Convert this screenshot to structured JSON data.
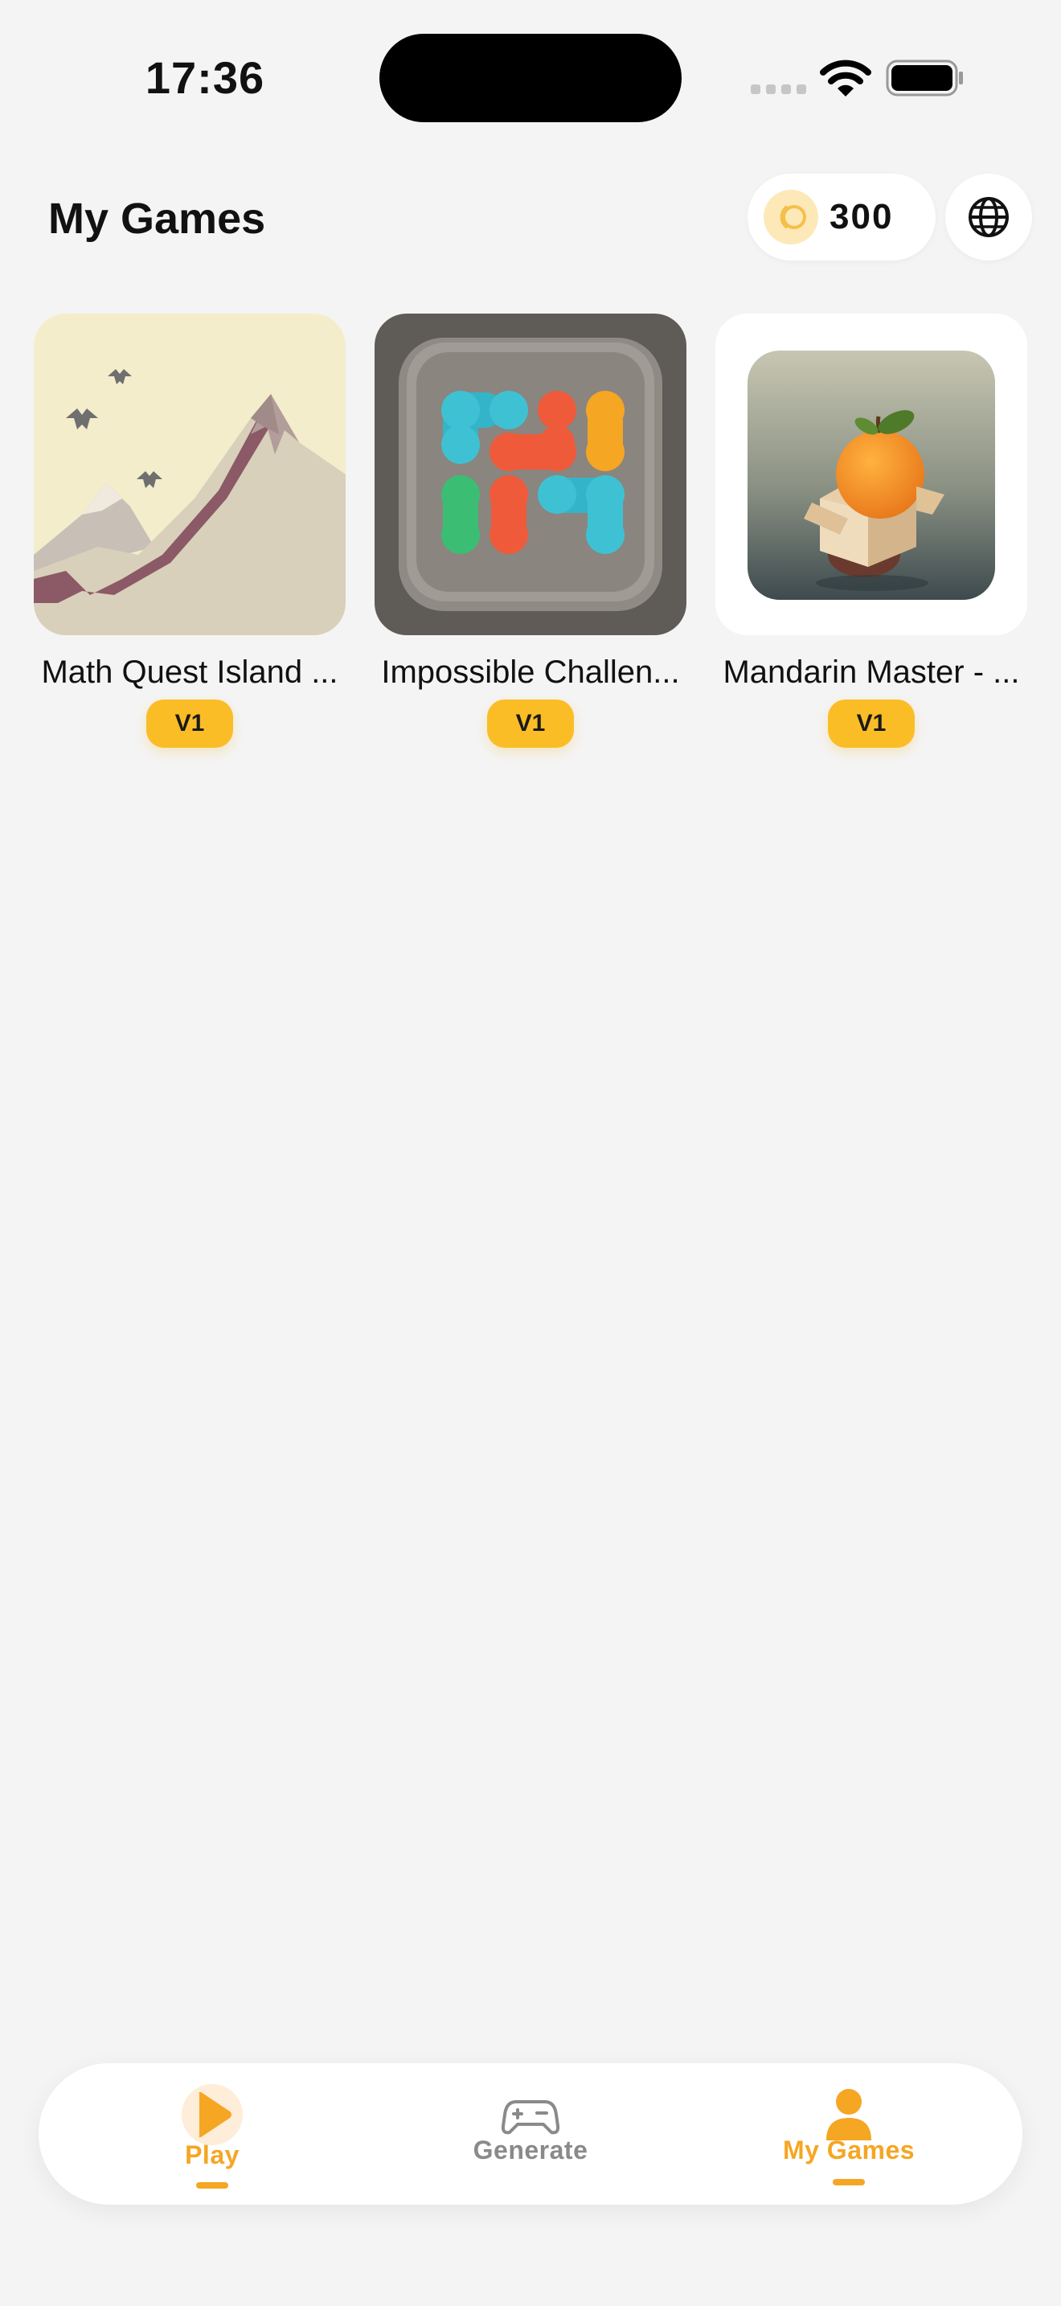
{
  "status_bar": {
    "time": "17:36",
    "icons": [
      "cellular-signal-icon",
      "wifi-icon",
      "battery-icon"
    ]
  },
  "header": {
    "title": "My Games",
    "coins": "300",
    "coin_icon": "coin-icon",
    "language_icon": "globe-icon"
  },
  "games": [
    {
      "title": "Math Quest Island ...",
      "version": "V1",
      "thumbnail": "mountain-landscape-art"
    },
    {
      "title": "Impossible Challen...",
      "version": "V1",
      "thumbnail": "colored-dots-puzzle-art"
    },
    {
      "title": "Mandarin Master - ...",
      "version": "V1",
      "thumbnail": "orange-in-box-art"
    }
  ],
  "tab_bar": {
    "tabs": [
      {
        "label": "Play",
        "icon": "play-icon",
        "active": false
      },
      {
        "label": "Generate",
        "icon": "gamepad-icon",
        "active": false
      },
      {
        "label": "My Games",
        "icon": "user-icon",
        "active": true
      }
    ]
  },
  "colors": {
    "accent": "#f5a623",
    "badge": "#fbbd26",
    "background": "#f4f4f4",
    "inactive_tab": "#8a8a8a"
  }
}
